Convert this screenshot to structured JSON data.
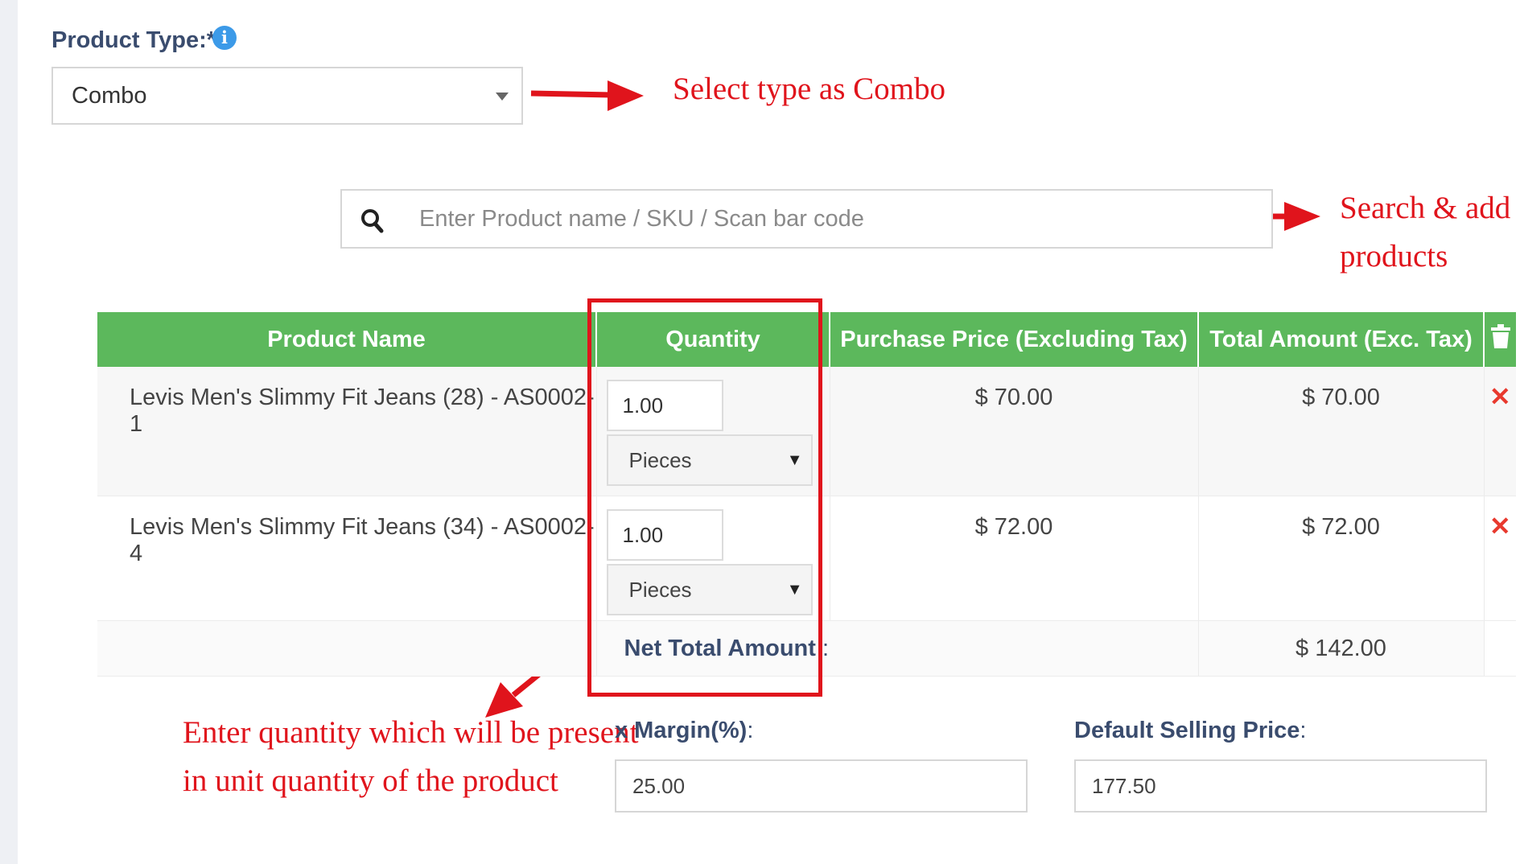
{
  "product_type": {
    "label": "Product Type:*",
    "info_icon": "i",
    "selected": "Combo"
  },
  "search": {
    "placeholder": "Enter Product name / SKU / Scan bar code"
  },
  "table": {
    "headers": {
      "product_name": "Product Name",
      "quantity": "Quantity",
      "purchase_price": "Purchase Price (Excluding Tax)",
      "total_amount": "Total Amount (Exc. Tax)",
      "delete_icon": "trash-icon"
    },
    "rows": [
      {
        "name": "Levis Men's Slimmy Fit Jeans (28) - AS0002-1",
        "qty": "1.00",
        "unit": "Pieces",
        "price": "$ 70.00",
        "total": "$ 70.00"
      },
      {
        "name": "Levis Men's Slimmy Fit Jeans (34) - AS0002-4",
        "qty": "1.00",
        "unit": "Pieces",
        "price": "$ 72.00",
        "total": "$ 72.00"
      }
    ],
    "remove_symbol": "✕",
    "net_total_label": "Net Total Amount",
    "net_total_colon": ":",
    "net_total_value": "$ 142.00"
  },
  "margin": {
    "label": "x Margin(%)",
    "colon": ":",
    "value": "25.00"
  },
  "selling_price": {
    "label": "Default Selling Price",
    "colon": ":",
    "value": "177.50"
  },
  "annotations": {
    "select_type": "Select type as Combo",
    "search_line1": "Search & add",
    "search_line2": "products",
    "quantity_line1": "Enter quantity which will be present",
    "quantity_line2": "in unit quantity of the product"
  },
  "colors": {
    "header_green": "#5cb85c",
    "annotation_red": "#e0141c",
    "label_navy": "#3a4c6e",
    "info_blue": "#3c9ae8"
  }
}
